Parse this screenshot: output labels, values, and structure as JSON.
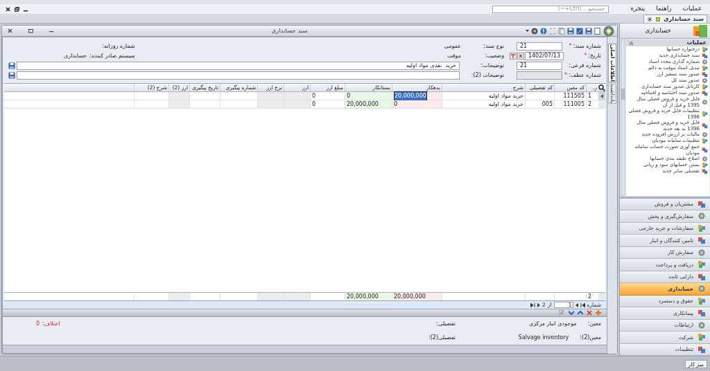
{
  "app_bar": {
    "menus": [
      "عملیات",
      "راهنما",
      "پنجره"
    ],
    "search": {
      "placeholder": "جستجو... (Ctrl+~)"
    }
  },
  "doc_tabs": [
    {
      "label": "سند حسابداری",
      "selected": true
    }
  ],
  "window": {
    "title": "سند حسابداری"
  },
  "side_tabs": [
    {
      "label": "اطلاعات اصلی",
      "selected": true
    },
    {
      "label": "یادداشت",
      "selected": false
    }
  ],
  "form": {
    "doc_number": {
      "label": "شماره سند:",
      "required_mark": "*",
      "value": "21"
    },
    "date": {
      "label": "تاریخ:",
      "required_mark": "*",
      "value": "1402/07/13"
    },
    "sub_number": {
      "label": "شماره فرعی:",
      "value": "21"
    },
    "ref_number": {
      "label": "شماره عطف:",
      "required_mark": "*",
      "disabled": true
    },
    "doc_type": {
      "label": "نوع سند:",
      "value": "عمومی"
    },
    "status": {
      "label": "وضعیت:",
      "value": "موقت"
    },
    "description": {
      "label": "توضیحات:",
      "value": "خرید  نقدی مواد اولیه"
    },
    "description_2": {
      "label": "توضیحات (2):"
    },
    "daily_number": {
      "label": "شماره روزانه:"
    },
    "issuer": {
      "label": "سیستم صادر کننده:",
      "value": "حسابداری"
    }
  },
  "grid": {
    "columns": [
      {
        "label": "ر.",
        "kind": "index"
      },
      {
        "label": "کد معین",
        "kind": "code"
      },
      {
        "label": "کد تفصیلی",
        "kind": "code"
      },
      {
        "label": "شرح",
        "kind": "text"
      },
      {
        "label": "بدهکار",
        "kind": "debit"
      },
      {
        "label": "بستانکار",
        "kind": "credit"
      },
      {
        "label": "مبلغ ارز",
        "kind": "amount"
      },
      {
        "label": "ارز",
        "kind": "readonly"
      },
      {
        "label": "نرخ ارز",
        "kind": "readonly"
      },
      {
        "label": "شماره پیگیری",
        "kind": "text"
      },
      {
        "label": "تاریخ پیگیری",
        "kind": "text"
      },
      {
        "label": "ارز (2)",
        "kind": "readonly"
      },
      {
        "label": "شرح (2)",
        "kind": "text"
      }
    ],
    "rows": [
      {
        "selected": true,
        "cells": [
          "1",
          "111505",
          null,
          "خرید مواد اولیه",
          {
            "text": "20,000,000",
            "selected": true
          },
          "0",
          "0",
          null,
          null,
          null,
          null,
          null,
          null
        ]
      },
      {
        "selected": false,
        "cells": [
          "2",
          "111005",
          "005",
          "خرید مواد اولیه",
          "0",
          "20,000,000",
          "0",
          null,
          null,
          null,
          null,
          null,
          null
        ]
      }
    ],
    "footer": {
      "count": "2",
      "totals": {
        "debit": "20,000,000",
        "credit": "20,000,000"
      }
    },
    "pager": {
      "label": "شماره",
      "current": "1",
      "of": "از",
      "total": "2"
    }
  },
  "details": {
    "items": [
      {
        "label": "معین:",
        "value": "موجودی انبار مرکزی"
      },
      {
        "label": "تفصیلی:"
      },
      {
        "label": "معین(2):",
        "value": "Salvage inventory"
      },
      {
        "label": "تفصیلی(2):"
      }
    ],
    "difference": {
      "label": "اختلاف:",
      "value": "0"
    }
  },
  "sidebar": {
    "title": "حسابداری",
    "section": {
      "title": "عملیات",
      "expanded": true,
      "items": [
        "درختواره حسابها",
        "سند حسابداری جدید",
        "شماره گذاری مجدد اسناد",
        "تبدیل اسناد موقت به دائم",
        "صدور سند تسعیر ارز",
        "صدور سند کل",
        "کارتابل صدور سند حسابداری",
        "صدور سند اختتامیه و افتتاحیه",
        "فایل خرید و فروش فصلی سال 1395 و قبل از آن",
        "تنظیمات فایل خرید و فروش فصلی 1396",
        "فایل خرید و فروش فصلی سال 1396 به بعد جدید",
        "مالیات بر ارزش افزوده جدید",
        "تنظیمات سامانه مودیان",
        "جمع آوری صورت حساب سامانه مودیان",
        "اصلاح طبقه بندی حسابها",
        "بستن حسابهای سود و زیانی",
        "تفصیلی سایر جدید"
      ]
    },
    "modules": [
      {
        "label": "مشتریان و فروش",
        "selected": false
      },
      {
        "label": "سفارش‌گیری و پخش",
        "selected": false
      },
      {
        "label": "سفارشات و خرید خارجی",
        "selected": false
      },
      {
        "label": "تامین کنندگان و انبار",
        "selected": false
      },
      {
        "label": "سفارش کار",
        "selected": false
      },
      {
        "label": "دریافت و پرداخت",
        "selected": false
      },
      {
        "label": "دارایی ثابت",
        "selected": false
      },
      {
        "label": "حسابداری",
        "selected": true
      },
      {
        "label": "حقوق و دستمزد",
        "selected": false
      },
      {
        "label": "پیمانکاری",
        "selected": false
      },
      {
        "label": "ارتباطات",
        "selected": false
      },
      {
        "label": "شرکت",
        "selected": false
      },
      {
        "label": "تنظیمات",
        "selected": false
      }
    ]
  },
  "status_bar": {
    "buttons": [
      "میز کار"
    ]
  }
}
